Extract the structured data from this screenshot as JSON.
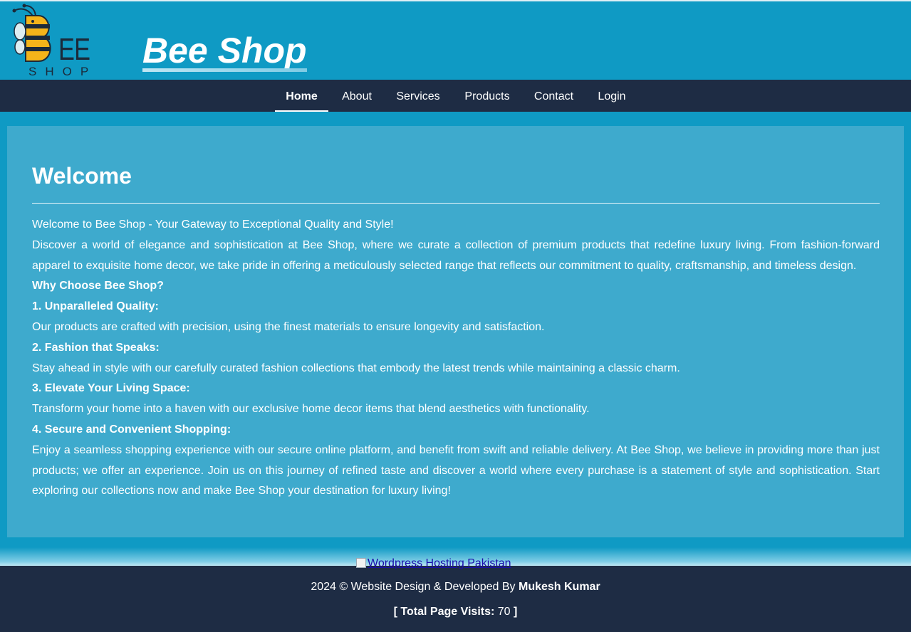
{
  "header": {
    "logo_letters": "EE",
    "logo_sub": "SHOP",
    "site_title": "Bee Shop"
  },
  "nav": {
    "items": [
      {
        "label": "Home",
        "active": true
      },
      {
        "label": "About"
      },
      {
        "label": "Services"
      },
      {
        "label": "Products"
      },
      {
        "label": "Contact"
      },
      {
        "label": "Login"
      }
    ]
  },
  "main": {
    "heading": "Welcome",
    "intro": "Welcome to Bee Shop - Your Gateway to Exceptional Quality and Style!",
    "paragraph1": "Discover a world of elegance and sophistication at Bee Shop, where we curate a collection of premium products that redefine luxury living. From fashion-forward apparel to exquisite home decor, we take pride in offering a meticulously selected range that reflects our commitment to quality, craftsmanship, and timeless design.",
    "why_heading": "Why Choose Bee Shop?",
    "points": [
      {
        "title": "1. Unparalleled Quality:",
        "text": "Our products are crafted with precision, using the finest materials to ensure longevity and satisfaction."
      },
      {
        "title": "2. Fashion that Speaks:",
        "text": "Stay ahead in style with our carefully curated fashion collections that embody the latest trends while maintaining a classic charm."
      },
      {
        "title": "3. Elevate Your Living Space:",
        "text": "Transform your home into a haven with our exclusive home decor items that blend aesthetics with functionality."
      },
      {
        "title": "4. Secure and Convenient Shopping:",
        "text": "Enjoy a seamless shopping experience with our secure online platform, and benefit from swift and reliable delivery. At Bee Shop, we believe in providing more than just products; we offer an experience. Join us on this journey of refined taste and discover a world where every purchase is a statement of style and sophistication. Start exploring our collections now and make Bee Shop your destination for luxury living!"
      }
    ]
  },
  "hosting_link": "Wordpress Hosting Pakistan",
  "footer": {
    "copyright": "2024 © Website Design & Developed By",
    "author": "Mukesh Kumar",
    "visits_open": "[",
    "visits_label": "Total Page Visits:",
    "visits_count": "70",
    "visits_close": "]"
  },
  "colors": {
    "header_bg": "#0f9ac4",
    "nav_bg": "#1e2c44",
    "content_bg": "#3eaacd",
    "footer_bg": "#1e2c44",
    "logo_bee_yellow": "#f4b41a",
    "logo_dark": "#1b2a3a"
  },
  "icons": {
    "logo": "bee-icon",
    "broken_image": "broken-image-icon"
  }
}
